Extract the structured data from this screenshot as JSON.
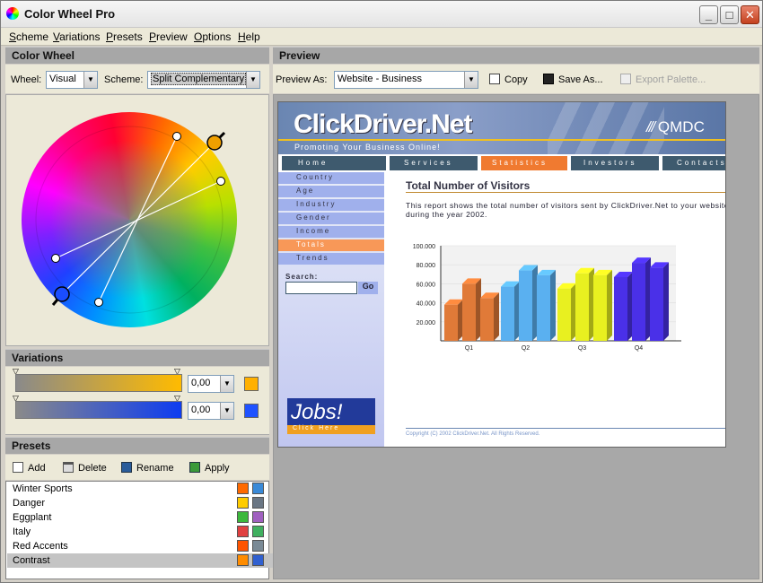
{
  "window": {
    "title": "Color Wheel Pro"
  },
  "menu": [
    "Scheme",
    "Variations",
    "Presets",
    "Preview",
    "Options",
    "Help"
  ],
  "color_wheel": {
    "title": "Color Wheel",
    "wheel_label": "Wheel:",
    "wheel_value": "Visual",
    "scheme_label": "Scheme:",
    "scheme_value": "Split Complementary"
  },
  "variations": {
    "title": "Variations",
    "rows": [
      {
        "value": "0,00",
        "swatch": "#ffb000",
        "gradient": [
          "#8a8a8a",
          "#ffbb00"
        ]
      },
      {
        "value": "0,00",
        "swatch": "#1f52ff",
        "gradient": [
          "#8a8a8a",
          "#0d3cf0"
        ]
      }
    ]
  },
  "presets": {
    "title": "Presets",
    "toolbar": {
      "add": "Add",
      "delete": "Delete",
      "rename": "Rename",
      "apply": "Apply"
    },
    "items": [
      {
        "name": "Winter Sports",
        "c1": "#ff6a00",
        "c2": "#3a8ad8",
        "selected": false
      },
      {
        "name": "Danger",
        "c1": "#ffcc00",
        "c2": "#6a7684",
        "selected": false
      },
      {
        "name": "Eggplant",
        "c1": "#3cb83c",
        "c2": "#a060c0",
        "selected": false
      },
      {
        "name": "Italy",
        "c1": "#e04040",
        "c2": "#40b060",
        "selected": false
      },
      {
        "name": "Red Accents",
        "c1": "#ff5500",
        "c2": "#7a8a96",
        "selected": false
      },
      {
        "name": "Contrast",
        "c1": "#ff8c00",
        "c2": "#3060d0",
        "selected": true
      }
    ]
  },
  "preview": {
    "title": "Preview",
    "preview_as_label": "Preview As:",
    "preview_as_value": "Website - Business",
    "copy": "Copy",
    "save_as": "Save As...",
    "export": "Export Palette..."
  },
  "site": {
    "logo": "ClickDriver.Net",
    "tagline": "Promoting Your Business Online!",
    "brand": "QMDC",
    "nav": [
      "Home",
      "Services",
      "Statistics",
      "Investors",
      "Contacts"
    ],
    "active_nav": "Statistics",
    "side_nav": [
      "Country",
      "Age",
      "Industry",
      "Gender",
      "Income",
      "Totals",
      "Trends"
    ],
    "active_side": "Totals",
    "search_label": "Search:",
    "go": "Go",
    "jobs": "Jobs!",
    "click_here": "Click Here",
    "heading": "Total Number of Visitors",
    "body": "This report shows the total number of visitors sent by ClickDriver.Net to your website during the year 2002.",
    "copyright": "Copyright (C) 2002 ClickDriver.Net. All Rights Reserved."
  },
  "chart_data": {
    "type": "bar",
    "categories": [
      "Q1",
      "Q2",
      "Q3",
      "Q4"
    ],
    "series": [
      {
        "values": [
          38000,
          60000,
          45000
        ],
        "color": "#e07a38"
      },
      {
        "values": [
          57000,
          74000,
          69000
        ],
        "color": "#5ab0f0"
      },
      {
        "values": [
          55000,
          71000,
          69000
        ],
        "color": "#e8f020"
      },
      {
        "values": [
          67000,
          82000,
          77000
        ],
        "color": "#4a30e8"
      }
    ],
    "yticks": [
      "100.000",
      "80.000",
      "60.000",
      "40.000",
      "20.000"
    ],
    "ylim": [
      0,
      100000
    ]
  }
}
